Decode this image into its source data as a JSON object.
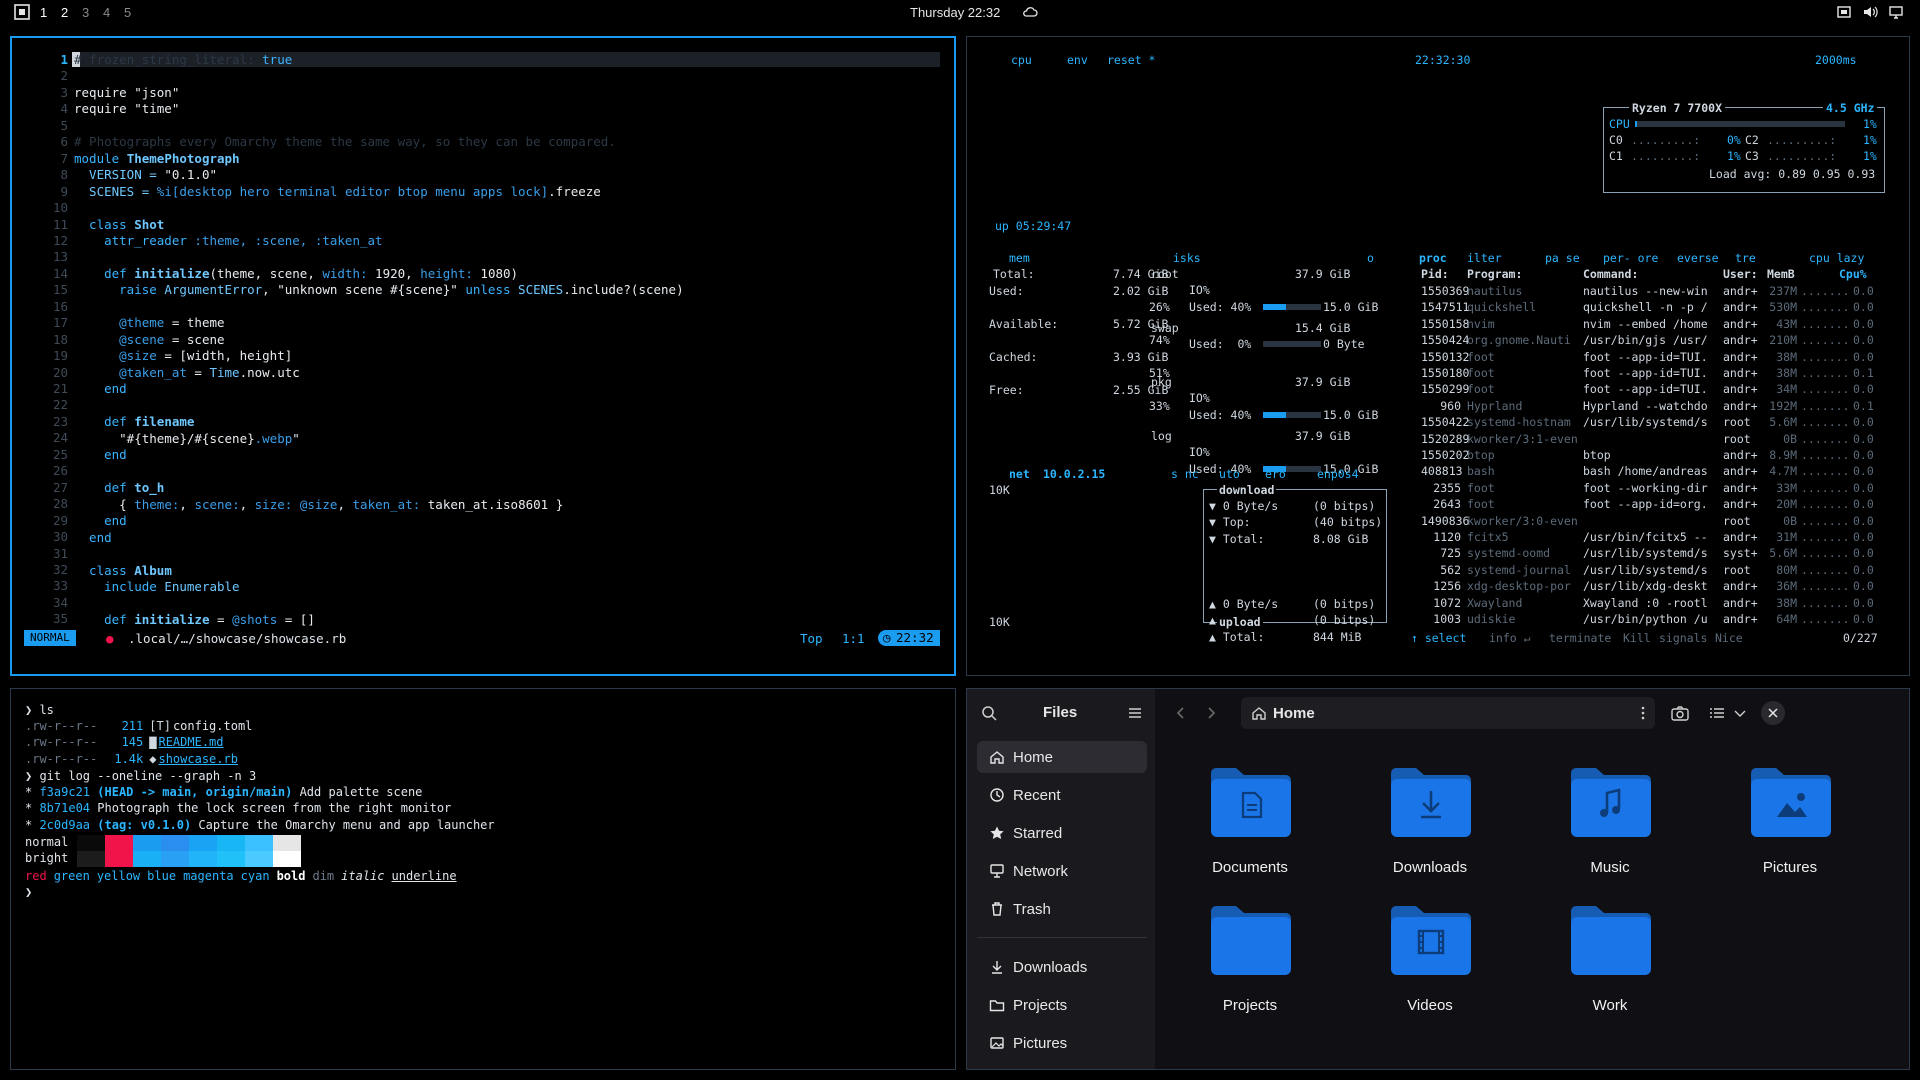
{
  "topbar": {
    "workspaces": [
      "1",
      "2",
      "3",
      "4",
      "5"
    ],
    "clock": "Thursday 22:32"
  },
  "nvim": {
    "lines": [
      {
        "n": "1",
        "cur": true
      },
      {
        "n": "2"
      },
      {
        "n": "3"
      },
      {
        "n": "4"
      },
      {
        "n": "5"
      },
      {
        "n": "6"
      },
      {
        "n": "7"
      },
      {
        "n": "8"
      },
      {
        "n": "9"
      },
      {
        "n": "10"
      },
      {
        "n": "11"
      },
      {
        "n": "12"
      },
      {
        "n": "13"
      },
      {
        "n": "14"
      },
      {
        "n": "15"
      },
      {
        "n": "16"
      },
      {
        "n": "17"
      },
      {
        "n": "18"
      },
      {
        "n": "19"
      },
      {
        "n": "20"
      },
      {
        "n": "21"
      },
      {
        "n": "22"
      },
      {
        "n": "23"
      },
      {
        "n": "24"
      },
      {
        "n": "25"
      },
      {
        "n": "26"
      },
      {
        "n": "27"
      },
      {
        "n": "28"
      },
      {
        "n": "29"
      },
      {
        "n": "30"
      },
      {
        "n": "31"
      },
      {
        "n": "32"
      },
      {
        "n": "33"
      },
      {
        "n": "34"
      },
      {
        "n": "35"
      }
    ],
    "code": {
      "l1_comment": "# frozen_string_literal: ",
      "l1_true": "true",
      "l3": "require \"json\"",
      "l4": "require \"time\"",
      "l6": "# Photographs every Omarchy theme the same way, so they can be compared.",
      "l7_kw": "module ",
      "l7_name": "ThemePhotograph",
      "l8a": "  VERSION = ",
      "l8b": "\"0.1.0\"",
      "l9a": "  SCENES = ",
      "l9b": "%i[desktop hero terminal editor btop menu apps lock]",
      "l9c": ".freeze",
      "l11_kw": "  class ",
      "l11_name": "Shot",
      "l12a": "    attr_reader ",
      "l12b": ":theme, :scene, :taken_at",
      "l14_kw": "    def ",
      "l14_name": "initialize",
      "l14a": "(theme, scene, ",
      "l14b": "width:",
      "l14c": " 1920, ",
      "l14d": "height:",
      "l14e": " 1080)",
      "l15a": "      raise ",
      "l15b": "ArgumentError",
      "l15c": ", \"unknown scene #{scene}\" ",
      "l15d": "unless",
      "l15e": " SCENES",
      "l15f": ".include?(scene)",
      "l17a": "      @theme",
      "l17b": " = theme",
      "l18a": "      @scene",
      "l18b": " = scene",
      "l19a": "      @size",
      "l19b": " = [width, height]",
      "l20a": "      @taken_at",
      "l20b": " = ",
      "l20c": "Time",
      "l20d": ".now.utc",
      "l21": "    end",
      "l23_kw": "    def ",
      "l23_name": "filename",
      "l24a": "      \"#{theme}/#{scene}",
      "l24b": ".webp",
      "l24c": "\"",
      "l25": "    end",
      "l27_kw": "    def ",
      "l27_name": "to_h",
      "l28a": "      { ",
      "l28b": "theme:",
      "l28c": ", ",
      "l28d": "scene:",
      "l28e": ", ",
      "l28f": "size:",
      "l28g": " @size",
      "l28h": ", ",
      "l28i": "taken_at:",
      "l28j": " taken_at.iso8601 }",
      "l29": "    end",
      "l30": "  end",
      "l32_kw": "  class ",
      "l32_name": "Album",
      "l33a": "    include ",
      "l33b": "Enumerable",
      "l35_kw": "    def ",
      "l35_name": "initialize",
      "l35a": " = ",
      "l35b": "@shots",
      "l35c": " = []"
    },
    "status": {
      "mode": "NORMAL",
      "path": ".local/…/showcase/showcase.rb",
      "position_word": "Top",
      "cursor": "1:1",
      "time": "22:32"
    }
  },
  "btop": {
    "header": {
      "cpu": "cpu",
      "env": "env",
      "reset": "reset *",
      "time": "22:32:30",
      "interval": "2000ms"
    },
    "cpu": {
      "model": "Ryzen 7 7700X",
      "freq": "4.5 GHz",
      "cpu_label": "CPU",
      "cpu_pct": "1%",
      "cores": [
        {
          "l": "C0",
          "p": "0%"
        },
        {
          "l": "C1",
          "p": "1%"
        },
        {
          "l": "C2",
          "p": "1%"
        },
        {
          "l": "C3",
          "p": "1%"
        }
      ],
      "load": "Load avg: 0.89 0.95 0.93",
      "uptime": "up 05:29:47"
    },
    "mem": {
      "title": "mem",
      "total_label": "Total:",
      "total": "7.74 GiB",
      "used_label": "Used:",
      "used": "2.02 GiB",
      "used_pct": "26%",
      "avail_label": "Available:",
      "avail": "5.72 GiB",
      "avail_pct": "74%",
      "cached_label": "Cached:",
      "cached": "3.93 GiB",
      "cached_pct": "51%",
      "free_label": "Free:",
      "free": "2.55 GiB",
      "free_pct": "33%"
    },
    "disks": {
      "title": "isks",
      "o": "o",
      "items": [
        {
          "name": "root",
          "size": "37.9 GiB",
          "io": "IO%",
          "used": "Used: 40%",
          "usedval": "15.0 GiB",
          "pct": 0.4
        },
        {
          "name": "swap",
          "size": "15.4 GiB",
          "io": "",
          "used": "Used:  0%",
          "usedval": "0 Byte",
          "pct": 0.0
        },
        {
          "name": "pkg",
          "size": "37.9 GiB",
          "io": "IO%",
          "used": "Used: 40%",
          "usedval": "15.0 GiB",
          "pct": 0.4
        },
        {
          "name": "log",
          "size": "37.9 GiB",
          "io": "IO%",
          "used": "Used: 40%",
          "usedval": "15.0 GiB",
          "pct": 0.4
        }
      ]
    },
    "net": {
      "title": "net",
      "ip": "10.0.2.15",
      "sync": "s nc",
      "auto": "uto",
      "zero": "ero",
      "iface": "enp0s4",
      "scale_top": "10K",
      "scale_bot": "10K",
      "download": "download",
      "dl": [
        {
          "k": "▼ 0 Byte/s",
          "v": "(0 bitps)"
        },
        {
          "k": "▼ Top:",
          "v": "(40 bitps)"
        },
        {
          "k": "▼ Total:",
          "v": "8.08 GiB"
        }
      ],
      "ul": [
        {
          "k": "▲ 0 Byte/s",
          "v": "(0 bitps)"
        },
        {
          "k": "▲ Top:",
          "v": "(0 bitps)"
        },
        {
          "k": "▲ Total:",
          "v": "844 MiB"
        }
      ],
      "upload": "upload"
    },
    "proc": {
      "title": "proc",
      "filter": "ilter",
      "pause": "pa se",
      "per": "per- ore",
      "reverse": "everse",
      "tree": "tre",
      "cpu_lazy": "cpu lazy",
      "headers": {
        "pid": "Pid:",
        "prog": "Program:",
        "cmd": "Command:",
        "user": "User:",
        "mem": "MemB",
        "cpu": "Cpu%"
      },
      "rows": [
        {
          "pid": "1550369",
          "prog": "nautilus",
          "cmd": "nautilus --new-win",
          "user": "andr+",
          "mem": "237M",
          "cpu": "0.0"
        },
        {
          "pid": "1547511",
          "prog": "quickshell",
          "cmd": "quickshell -n -p /",
          "user": "andr+",
          "mem": "530M",
          "cpu": "0.0"
        },
        {
          "pid": "1550158",
          "prog": "nvim",
          "cmd": "nvim --embed /home",
          "user": "andr+",
          "mem": "43M",
          "cpu": "0.0"
        },
        {
          "pid": "1550424",
          "prog": "org.gnome.Nauti",
          "cmd": "/usr/bin/gjs /usr/",
          "user": "andr+",
          "mem": "210M",
          "cpu": "0.0"
        },
        {
          "pid": "1550132",
          "prog": "foot",
          "cmd": "foot --app-id=TUI.",
          "user": "andr+",
          "mem": "38M",
          "cpu": "0.0"
        },
        {
          "pid": "1550180",
          "prog": "foot",
          "cmd": "foot --app-id=TUI.",
          "user": "andr+",
          "mem": "38M",
          "cpu": "0.1"
        },
        {
          "pid": "1550299",
          "prog": "foot",
          "cmd": "foot --app-id=TUI.",
          "user": "andr+",
          "mem": "34M",
          "cpu": "0.0"
        },
        {
          "pid": "960",
          "prog": "Hyprland",
          "cmd": "Hyprland --watchdo",
          "user": "andr+",
          "mem": "192M",
          "cpu": "0.1"
        },
        {
          "pid": "1550422",
          "prog": "systemd-hostnam",
          "cmd": "/usr/lib/systemd/s",
          "user": "root",
          "mem": "5.6M",
          "cpu": "0.0"
        },
        {
          "pid": "1520289",
          "prog": "kworker/3:1-even",
          "cmd": "",
          "user": "root",
          "mem": "0B",
          "cpu": "0.0"
        },
        {
          "pid": "1550202",
          "prog": "btop",
          "cmd": "btop",
          "user": "andr+",
          "mem": "8.9M",
          "cpu": "0.0"
        },
        {
          "pid": "408813",
          "prog": "bash",
          "cmd": "bash /home/andreas",
          "user": "andr+",
          "mem": "4.7M",
          "cpu": "0.0"
        },
        {
          "pid": "2355",
          "prog": "foot",
          "cmd": "foot --working-dir",
          "user": "andr+",
          "mem": "33M",
          "cpu": "0.0"
        },
        {
          "pid": "2643",
          "prog": "foot",
          "cmd": "foot --app-id=org.",
          "user": "andr+",
          "mem": "20M",
          "cpu": "0.0"
        },
        {
          "pid": "1490836",
          "prog": "kworker/3:0-even",
          "cmd": "",
          "user": "root",
          "mem": "0B",
          "cpu": "0.0"
        },
        {
          "pid": "1120",
          "prog": "fcitx5",
          "cmd": "/usr/bin/fcitx5 --",
          "user": "andr+",
          "mem": "31M",
          "cpu": "0.0"
        },
        {
          "pid": "725",
          "prog": "systemd-oomd",
          "cmd": "/usr/lib/systemd/s",
          "user": "syst+",
          "mem": "5.6M",
          "cpu": "0.0"
        },
        {
          "pid": "562",
          "prog": "systemd-journal",
          "cmd": "/usr/lib/systemd/s",
          "user": "root",
          "mem": "80M",
          "cpu": "0.0"
        },
        {
          "pid": "1256",
          "prog": "xdg-desktop-por",
          "cmd": "/usr/lib/xdg-deskt",
          "user": "andr+",
          "mem": "36M",
          "cpu": "0.0"
        },
        {
          "pid": "1072",
          "prog": "Xwayland",
          "cmd": "Xwayland :0 -rootl",
          "user": "andr+",
          "mem": "38M",
          "cpu": "0.0"
        },
        {
          "pid": "1003",
          "prog": "udiskie",
          "cmd": "/usr/bin/python /u",
          "user": "andr+",
          "mem": "64M",
          "cpu": "0.0"
        }
      ],
      "footer": {
        "select": "↑ select",
        "info": "info ↵",
        "terminate": "terminate",
        "kill": "Kill",
        "signals": "signals",
        "nice": "Nice",
        "count": "0/227"
      }
    }
  },
  "terminal": {
    "prompt1": "❯ ls",
    "files": [
      {
        "perm": ".rw-r--r--",
        "size": "211",
        "icon": "[T]",
        "name": "config.toml",
        "link": false
      },
      {
        "perm": ".rw-r--r--",
        "size": "145",
        "icon": "▇",
        "name": "README.md",
        "link": true
      },
      {
        "perm": ".rw-r--r--",
        "size": "1.4k",
        "icon": "◆",
        "name": "showcase.rb",
        "link": true
      }
    ],
    "prompt2": "❯ git log --oneline --graph -n 3",
    "commits": [
      {
        "hash": "f3a9c21",
        "refs": "(HEAD -> main, origin/main)",
        "msg": " Add palette scene"
      },
      {
        "hash": "8b71e04",
        "refs": "",
        "msg": " Photograph the lock screen from the right monitor"
      },
      {
        "hash": "2c0d9aa",
        "refs": "(tag: v0.1.0)",
        "msg": " Capture the Omarchy menu and app launcher"
      }
    ],
    "normal_label": "normal",
    "bright_label": "bright",
    "palette_normal": [
      "#0a0a0a",
      "#f0144b",
      "#1a9cf0",
      "#2a8ef0",
      "#1aa3f5",
      "#18b6f5",
      "#3ac0ff",
      "#e6e6e6"
    ],
    "palette_bright": [
      "#1c1c1c",
      "#f0144b",
      "#1ab0f5",
      "#2aa0f5",
      "#22b4f8",
      "#20c0f8",
      "#4acaff",
      "#ffffff"
    ],
    "styles": [
      "red",
      "green",
      "yellow",
      "blue",
      "magenta",
      "cyan",
      "bold",
      "dim",
      "italic",
      "underline"
    ],
    "prompt3": "❯"
  },
  "files": {
    "title": "Files",
    "breadcrumb": "Home",
    "sidebar": [
      {
        "label": "Home",
        "icon": "home-icon",
        "active": true
      },
      {
        "label": "Recent",
        "icon": "clock-icon"
      },
      {
        "label": "Starred",
        "icon": "star-icon"
      },
      {
        "label": "Network",
        "icon": "network-icon"
      },
      {
        "label": "Trash",
        "icon": "trash-icon"
      }
    ],
    "bookmarks": [
      {
        "label": "Downloads",
        "icon": "download-icon"
      },
      {
        "label": "Projects",
        "icon": "folder-icon"
      },
      {
        "label": "Pictures",
        "icon": "image-icon"
      }
    ],
    "folders": [
      {
        "label": "Documents",
        "emblem": "document"
      },
      {
        "label": "Downloads",
        "emblem": "download"
      },
      {
        "label": "Music",
        "emblem": "music"
      },
      {
        "label": "Pictures",
        "emblem": "picture"
      },
      {
        "label": "Projects",
        "emblem": "none"
      },
      {
        "label": "Videos",
        "emblem": "video"
      },
      {
        "label": "Work",
        "emblem": "none"
      }
    ],
    "accent": "#1a75e8"
  }
}
